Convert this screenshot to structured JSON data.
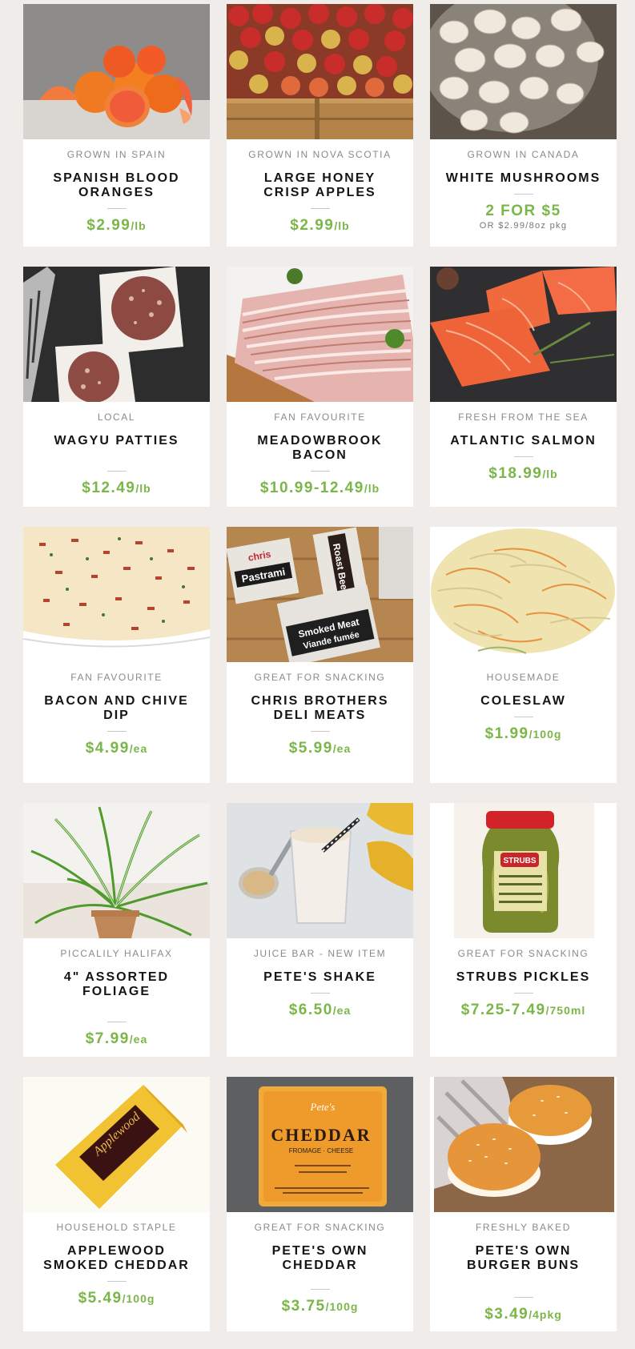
{
  "colors": {
    "accent": "#7ab648",
    "background": "#efecea",
    "card": "#ffffff"
  },
  "products": [
    {
      "icon": "blood-oranges-photo",
      "origin": "GROWN IN SPAIN",
      "name": "SPANISH BLOOD ORANGES",
      "price": "$2.99",
      "unit": "/lb"
    },
    {
      "icon": "apples-crate-photo",
      "origin": "GROWN IN NOVA SCOTIA",
      "name": "LARGE HONEY CRISP APPLES",
      "price": "$2.99",
      "unit": "/lb"
    },
    {
      "icon": "mushrooms-photo",
      "origin": "GROWN IN CANADA",
      "name": "WHITE MUSHROOMS",
      "price": "2 FOR $5",
      "unit": "",
      "note": "OR $2.99/8oz pkg"
    },
    {
      "icon": "wagyu-patties-photo",
      "origin": "LOCAL",
      "name": "WAGYU PATTIES",
      "price": "$12.49",
      "unit": "/lb"
    },
    {
      "icon": "bacon-photo",
      "origin": "FAN FAVOURITE",
      "name": "MEADOWBROOK BACON",
      "price": "$10.99-12.49",
      "unit": "/lb"
    },
    {
      "icon": "salmon-photo",
      "origin": "FRESH FROM THE SEA",
      "name": "ATLANTIC SALMON",
      "price": "$18.99",
      "unit": "/lb"
    },
    {
      "icon": "dip-photo",
      "origin": "FAN FAVOURITE",
      "name": "BACON AND CHIVE DIP",
      "price": "$4.99",
      "unit": "/ea"
    },
    {
      "icon": "deli-meats-photo",
      "origin": "GREAT FOR SNACKING",
      "name": "CHRIS BROTHERS DELI MEATS",
      "price": "$5.99",
      "unit": "/ea"
    },
    {
      "icon": "coleslaw-photo",
      "origin": "HOUSEMADE",
      "name": "COLESLAW",
      "price": "$1.99",
      "unit": "/100g"
    },
    {
      "icon": "plant-photo",
      "origin": "PICCALILY HALIFAX",
      "name": "4\" ASSORTED FOLIAGE",
      "price": "$7.99",
      "unit": "/ea"
    },
    {
      "icon": "shake-photo",
      "origin": "JUICE BAR - NEW ITEM",
      "name": "PETE'S SHAKE",
      "price": "$6.50",
      "unit": "/ea"
    },
    {
      "icon": "pickles-jar-photo",
      "origin": "GREAT FOR SNACKING",
      "name": "STRUBS PICKLES",
      "price": "$7.25-7.49",
      "unit": "/750ml"
    },
    {
      "icon": "applewood-cheddar-photo",
      "origin": "HOUSEHOLD STAPLE",
      "name": "APPLEWOOD SMOKED CHEDDAR",
      "price": "$5.49",
      "unit": "/100g"
    },
    {
      "icon": "cheddar-block-photo",
      "origin": "GREAT FOR SNACKING",
      "name": "PETE'S OWN CHEDDAR",
      "price": "$3.75",
      "unit": "/100g"
    },
    {
      "icon": "burger-buns-photo",
      "origin": "FRESHLY BAKED",
      "name": "PETE'S OWN BURGER BUNS",
      "price": "$3.49",
      "unit": "/4pkg"
    }
  ],
  "image_text": {
    "deli_brand": "chris",
    "deli_pastrami": "Pastrami",
    "deli_roast_beef": "Roast Beef",
    "deli_smoked_meat": "Smoked Meat",
    "deli_smoked_meat_fr": "Viande fumée",
    "pickles_brand": "STRUBS",
    "cheddar_brand": "Pete's",
    "cheddar_label": "CHEDDAR",
    "cheddar_sub": "FROMAGE · CHEESE",
    "applewood_label": "Applewood"
  }
}
